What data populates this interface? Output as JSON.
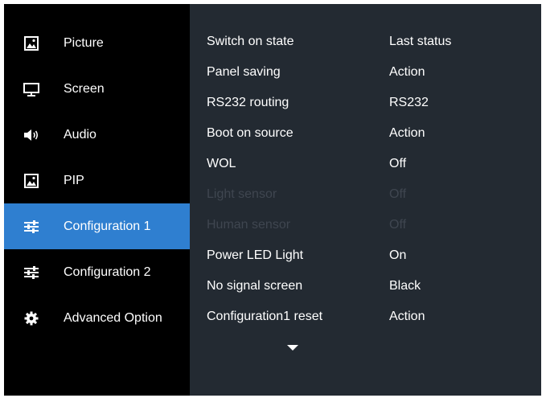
{
  "sidebar": {
    "items": [
      {
        "label": "Picture",
        "icon": "picture-icon",
        "active": false
      },
      {
        "label": "Screen",
        "icon": "monitor-icon",
        "active": false
      },
      {
        "label": "Audio",
        "icon": "speaker-icon",
        "active": false
      },
      {
        "label": "PIP",
        "icon": "pip-icon",
        "active": false
      },
      {
        "label": "Configuration 1",
        "icon": "sliders-icon",
        "active": true
      },
      {
        "label": "Configuration 2",
        "icon": "sliders-icon",
        "active": false
      },
      {
        "label": "Advanced Option",
        "icon": "gear-icon",
        "active": false
      }
    ]
  },
  "settings": {
    "rows": [
      {
        "name": "Switch on state",
        "value": "Last status",
        "enabled": true
      },
      {
        "name": "Panel saving",
        "value": "Action",
        "enabled": true
      },
      {
        "name": "RS232 routing",
        "value": "RS232",
        "enabled": true
      },
      {
        "name": "Boot on source",
        "value": "Action",
        "enabled": true
      },
      {
        "name": "WOL",
        "value": "Off",
        "enabled": true
      },
      {
        "name": "Light sensor",
        "value": "Off",
        "enabled": false
      },
      {
        "name": "Human sensor",
        "value": "Off",
        "enabled": false
      },
      {
        "name": "Power LED Light",
        "value": "On",
        "enabled": true
      },
      {
        "name": "No signal screen",
        "value": "Black",
        "enabled": true
      },
      {
        "name": "Configuration1 reset",
        "value": "Action",
        "enabled": true
      }
    ],
    "more_icon": "chevron-down-icon"
  },
  "colors": {
    "sidebar_bg": "#000000",
    "panel_bg": "#232a32",
    "active_highlight": "#2f7fd0",
    "text": "#ffffff",
    "disabled_text": "#3f4650"
  }
}
